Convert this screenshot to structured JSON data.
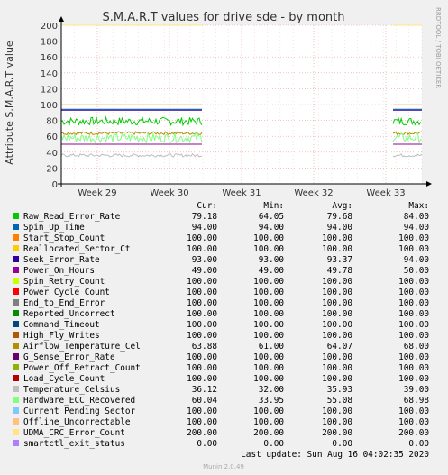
{
  "chart_data": {
    "type": "line",
    "title": "S.M.A.R.T values for drive sde - by month",
    "ylabel": "Attribute S.M.A.R.T value",
    "watermark": "RRDTOOL / TOBI OETIKER",
    "ylim": [
      0,
      200
    ],
    "yticks": [
      0,
      20,
      40,
      60,
      80,
      100,
      120,
      140,
      160,
      180,
      200
    ],
    "xticks": [
      "Week 29",
      "Week 30",
      "Week 31",
      "Week 32",
      "Week 33"
    ],
    "grid": true,
    "data_segments": [
      [
        0,
        0.39
      ],
      [
        0.92,
        1.0
      ]
    ],
    "columns": [
      "Cur:",
      "Min:",
      "Avg:",
      "Max:"
    ],
    "series": [
      {
        "name": "Raw_Read_Error_Rate",
        "color": "#00cc00",
        "cur": "79.18",
        "min": "64.05",
        "avg": "79.68",
        "max": "84.00",
        "level": 79,
        "noise": 5
      },
      {
        "name": "Spin_Up_Time",
        "color": "#0066b3",
        "cur": "94.00",
        "min": "94.00",
        "avg": "94.00",
        "max": "94.00",
        "level": 94,
        "noise": 0
      },
      {
        "name": "Start_Stop_Count",
        "color": "#ff8000",
        "cur": "100.00",
        "min": "100.00",
        "avg": "100.00",
        "max": "100.00",
        "level": 100,
        "noise": 0
      },
      {
        "name": "Reallocated_Sector_Ct",
        "color": "#ffcc00",
        "cur": "100.00",
        "min": "100.00",
        "avg": "100.00",
        "max": "100.00",
        "level": 100,
        "noise": 0
      },
      {
        "name": "Seek_Error_Rate",
        "color": "#330099",
        "cur": "93.00",
        "min": "93.00",
        "avg": "93.37",
        "max": "94.00",
        "level": 93,
        "noise": 0
      },
      {
        "name": "Power_On_Hours",
        "color": "#990099",
        "cur": "49.00",
        "min": "49.00",
        "avg": "49.78",
        "max": "50.00",
        "level": 50,
        "noise": 0
      },
      {
        "name": "Spin_Retry_Count",
        "color": "#ccff00",
        "cur": "100.00",
        "min": "100.00",
        "avg": "100.00",
        "max": "100.00",
        "level": 100,
        "noise": 0
      },
      {
        "name": "Power_Cycle_Count",
        "color": "#ff0000",
        "cur": "100.00",
        "min": "100.00",
        "avg": "100.00",
        "max": "100.00",
        "level": 100,
        "noise": 0
      },
      {
        "name": "End_to_End_Error",
        "color": "#808080",
        "cur": "100.00",
        "min": "100.00",
        "avg": "100.00",
        "max": "100.00",
        "level": 100,
        "noise": 0
      },
      {
        "name": "Reported_Uncorrect",
        "color": "#008f00",
        "cur": "100.00",
        "min": "100.00",
        "avg": "100.00",
        "max": "100.00",
        "level": 100,
        "noise": 0
      },
      {
        "name": "Command_Timeout",
        "color": "#00487d",
        "cur": "100.00",
        "min": "100.00",
        "avg": "100.00",
        "max": "100.00",
        "level": 100,
        "noise": 0
      },
      {
        "name": "High_Fly_Writes",
        "color": "#b35a00",
        "cur": "100.00",
        "min": "100.00",
        "avg": "100.00",
        "max": "100.00",
        "level": 100,
        "noise": 0
      },
      {
        "name": "Airflow_Temperature_Cel",
        "color": "#b38f00",
        "cur": "63.88",
        "min": "61.00",
        "avg": "64.07",
        "max": "68.00",
        "level": 64,
        "noise": 2
      },
      {
        "name": "G_Sense_Error_Rate",
        "color": "#6b006b",
        "cur": "100.00",
        "min": "100.00",
        "avg": "100.00",
        "max": "100.00",
        "level": 100,
        "noise": 0
      },
      {
        "name": "Power_Off_Retract_Count",
        "color": "#8fb300",
        "cur": "100.00",
        "min": "100.00",
        "avg": "100.00",
        "max": "100.00",
        "level": 100,
        "noise": 0
      },
      {
        "name": "Load_Cycle_Count",
        "color": "#b30000",
        "cur": "100.00",
        "min": "100.00",
        "avg": "100.00",
        "max": "100.00",
        "level": 100,
        "noise": 0
      },
      {
        "name": "Temperature_Celsius",
        "color": "#bebebe",
        "cur": "36.12",
        "min": "32.00",
        "avg": "35.93",
        "max": "39.00",
        "level": 36,
        "noise": 2
      },
      {
        "name": "Hardware_ECC_Recovered",
        "color": "#80ff80",
        "cur": "60.04",
        "min": "33.95",
        "avg": "55.08",
        "max": "68.98",
        "level": 58,
        "noise": 6
      },
      {
        "name": "Current_Pending_Sector",
        "color": "#80c9ff",
        "cur": "100.00",
        "min": "100.00",
        "avg": "100.00",
        "max": "100.00",
        "level": 100,
        "noise": 0
      },
      {
        "name": "Offline_Uncorrectable",
        "color": "#ffc080",
        "cur": "100.00",
        "min": "100.00",
        "avg": "100.00",
        "max": "100.00",
        "level": 100,
        "noise": 0
      },
      {
        "name": "UDMA_CRC_Error_Count",
        "color": "#ffe680",
        "cur": "200.00",
        "min": "200.00",
        "avg": "200.00",
        "max": "200.00",
        "level": 200,
        "noise": 0
      },
      {
        "name": "smartctl_exit_status",
        "color": "#aa80ff",
        "cur": "0.00",
        "min": "0.00",
        "avg": "0.00",
        "max": "0.00",
        "level": 0,
        "noise": 0
      }
    ]
  },
  "footer": {
    "last_update": "Last update: Sun Aug 16 04:02:35 2020",
    "version": "Munin 2.0.49"
  },
  "colors": {
    "background": "#f0f0f0",
    "plot_background": "#ffffff",
    "grid": "#e5a0a0",
    "axis": "#000000"
  }
}
